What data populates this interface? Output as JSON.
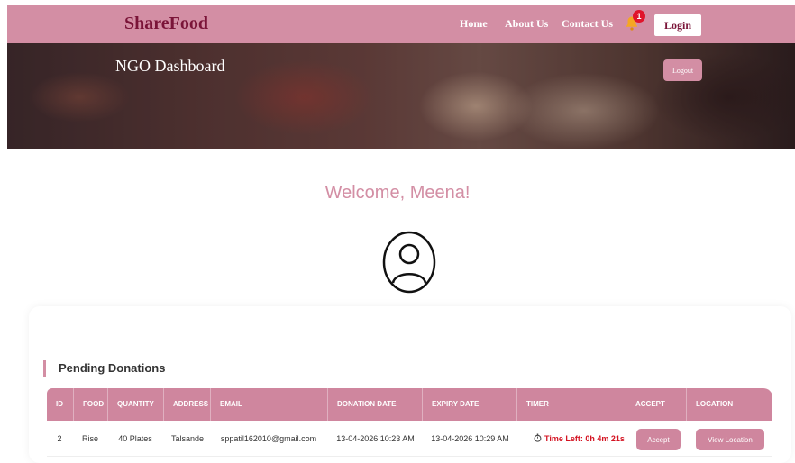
{
  "navbar": {
    "brand": "ShareFood",
    "links": [
      "Home",
      "About Us",
      "Contact Us"
    ],
    "notification_count": "1",
    "login_label": "Login"
  },
  "hero": {
    "title": "NGO Dashboard",
    "logout_label": "Logout"
  },
  "welcome": {
    "text": "Welcome, Meena!"
  },
  "donations": {
    "title": "Pending Donations",
    "columns": [
      "ID",
      "FOOD",
      "QUANTITY",
      "ADDRESS",
      "EMAIL",
      "DONATION DATE",
      "EXPIRY DATE",
      "TIMER",
      "ACCEPT",
      "LOCATION"
    ],
    "rows": [
      {
        "id": "2",
        "food": "Rise",
        "quantity": "40 Plates",
        "address": "Talsande",
        "email": "sppatil162010@gmail.com",
        "donation_date": "13-04-2026 10:23 AM",
        "expiry_date": "13-04-2026 10:29 AM",
        "timer": "Time Left: 0h 4m 21s",
        "accept_label": "Accept",
        "location_label": "View Location"
      }
    ]
  },
  "colors": {
    "accent": "#d38ea4",
    "brand": "#7a1438",
    "timer": "#d41322"
  }
}
